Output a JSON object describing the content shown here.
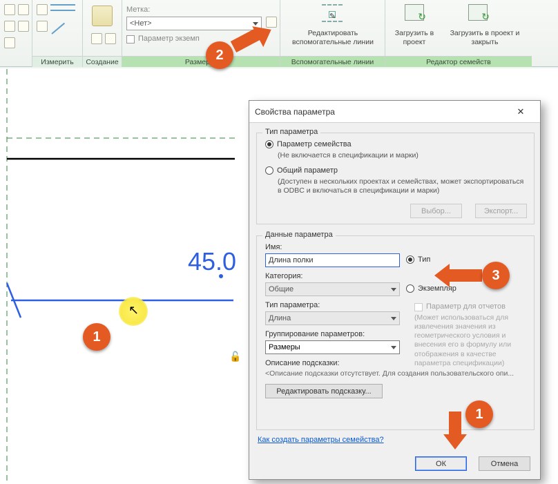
{
  "ribbon": {
    "mark_label_caption": "Метка:",
    "mark_value": "<Нет>",
    "instance_param_checkbox": "Параметр экземп",
    "groups": {
      "measure": "Измерить",
      "create": "Создание",
      "size_m": "Размер м",
      "aux": "Вспомогательные линии",
      "family_editor": "Редактор семейств"
    },
    "edit_aux_lines": "Редактировать вспомогательные линии",
    "load_project": "Загрузить в проект",
    "load_close": "Загрузить в проект и закрыть"
  },
  "drawing": {
    "dim_value": "45.0"
  },
  "callouts": {
    "c1": "1",
    "c2": "2",
    "c3": "3",
    "c1b": "1"
  },
  "dialog": {
    "title": "Свойства параметра",
    "param_type_group": "Тип параметра",
    "family_param": "Параметр семейства",
    "family_param_note": "(Не включается в спецификации и марки)",
    "shared_param": "Общий параметр",
    "shared_param_note": "(Доступен в нескольких проектах и семействах, может экспортироваться в ODBC и включаться в спецификации и марки)",
    "btn_select": "Выбор...",
    "btn_export": "Экспорт...",
    "param_data_group": "Данные параметра",
    "name_label": "Имя:",
    "name_value": "Длина полки",
    "radio_type": "Тип",
    "category_label": "Категория:",
    "category_value": "Общие",
    "radio_instance": "Экземпляр",
    "type_param_label": "Тип параметра:",
    "type_param_value": "Длина",
    "report_checkbox": "Параметр для отчетов",
    "report_note": "(Может использоваться для извлечения значения из геометрического условия и внесения его в формулу или отображения в качестве параметра спецификации)",
    "grouping_label": "Группирование параметров:",
    "grouping_value": "Размеры",
    "tooltip_label": "Описание подсказки:",
    "tooltip_text": "<Описание подсказки отсутствует. Для создания пользовательского опи...",
    "edit_tooltip_btn": "Редактировать подсказку...",
    "help_link": "Как создать параметры семейства?",
    "ok": "ОК",
    "cancel": "Отмена"
  }
}
